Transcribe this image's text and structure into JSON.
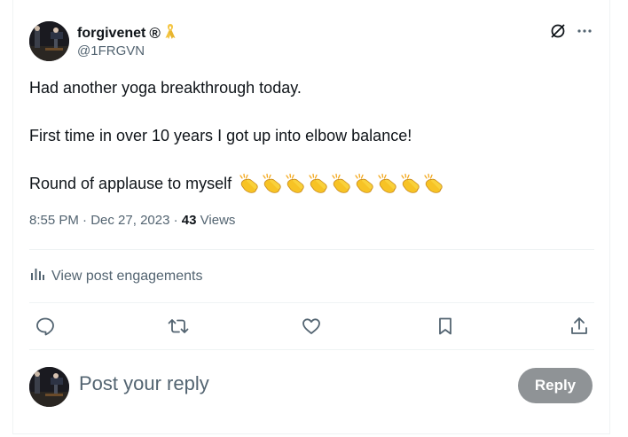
{
  "post": {
    "display_name": "forgivenet",
    "registered_mark": "®",
    "handle": "@1FRGVN",
    "lines": [
      "Had another yoga breakthrough today.",
      "First time in over 10 years I got up into elbow balance!",
      "Round of applause to myself"
    ],
    "clap_count": 9,
    "time": "8:55 PM",
    "date": "Dec 27, 2023",
    "views_count": "43",
    "views_label": "Views"
  },
  "engagements": {
    "label": "View post engagements",
    "icon": "analytics-icon"
  },
  "actions": [
    "reply-icon",
    "retweet-icon",
    "like-icon",
    "bookmark-icon",
    "share-icon"
  ],
  "reply_box": {
    "placeholder": "Post your reply",
    "button_label": "Reply"
  },
  "colors": {
    "text": "#0f1419",
    "muted": "#536471",
    "divider": "#eff3f4",
    "reply_button_disabled": "#8f9396",
    "ribbon": "#f4c542"
  }
}
